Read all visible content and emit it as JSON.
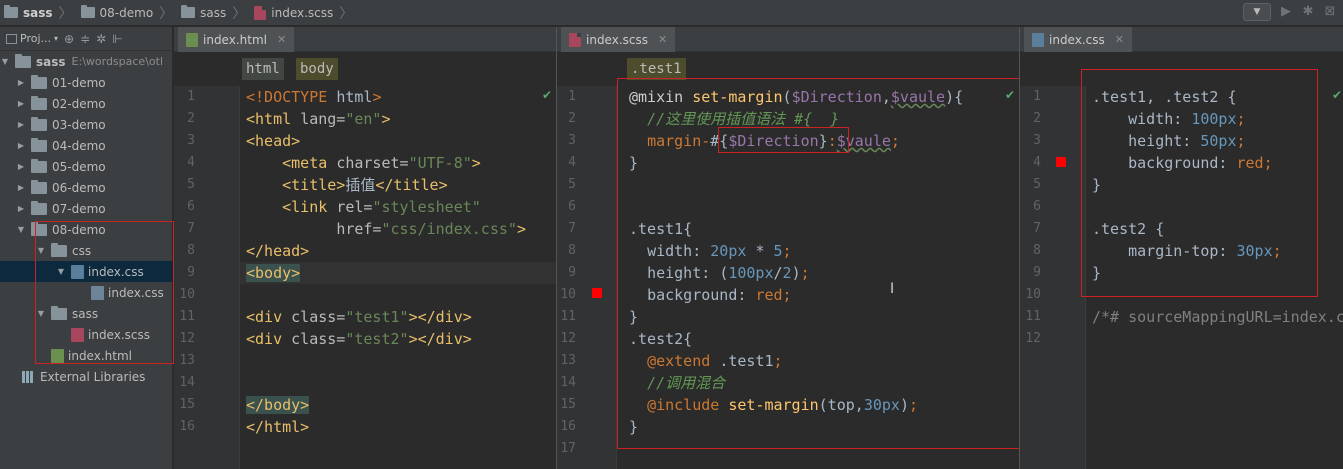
{
  "breadcrumb": [
    "sass",
    "08-demo",
    "sass",
    "index.scss"
  ],
  "toolbar_icons": [
    "dropdown-icon",
    "run-icon",
    "debug-icon",
    "coverage-icon"
  ],
  "project": {
    "tab_label": "Proj...",
    "root": {
      "name": "sass",
      "path": "E:\\wordspace\\otl"
    },
    "items": [
      {
        "label": "01-demo",
        "type": "folder"
      },
      {
        "label": "02-demo",
        "type": "folder"
      },
      {
        "label": "03-demo",
        "type": "folder"
      },
      {
        "label": "04-demo",
        "type": "folder"
      },
      {
        "label": "05-demo",
        "type": "folder"
      },
      {
        "label": "06-demo",
        "type": "folder"
      },
      {
        "label": "07-demo",
        "type": "folder"
      },
      {
        "label": "08-demo",
        "type": "folder"
      },
      {
        "label": "css",
        "type": "folder"
      },
      {
        "label": "index.css",
        "type": "css"
      },
      {
        "label": "index.css",
        "type": "map"
      },
      {
        "label": "sass",
        "type": "folder"
      },
      {
        "label": "index.scss",
        "type": "scss"
      },
      {
        "label": "index.html",
        "type": "html"
      },
      {
        "label": "External Libraries",
        "type": "lib"
      }
    ]
  },
  "panes": {
    "html": {
      "tab": "index.html",
      "crumbs": [
        "html",
        "body"
      ],
      "line_numbers": [
        "1",
        "2",
        "3",
        "4",
        "5",
        "6",
        "7",
        "8",
        "9",
        "10",
        "11",
        "12",
        "13",
        "14",
        "15",
        "16"
      ]
    },
    "scss": {
      "tab": "index.scss",
      "crumbs": [
        ".test1"
      ],
      "line_numbers": [
        "1",
        "2",
        "3",
        "4",
        "5",
        "6",
        "7",
        "8",
        "9",
        "10",
        "11",
        "12",
        "13",
        "14",
        "15",
        "16",
        "17"
      ]
    },
    "css": {
      "tab": "index.css",
      "line_numbers": [
        "1",
        "2",
        "3",
        "4",
        "5",
        "6",
        "7",
        "8",
        "9",
        "10",
        "11",
        "12"
      ]
    }
  },
  "code_html": [
    "<!DOCTYPE html>",
    "<html lang=\"en\">",
    "<head>",
    "    <meta charset=\"UTF-8\">",
    "    <title>插值</title>",
    "    <link rel=\"stylesheet\"",
    "          href=\"css/index.css\">",
    "</head>",
    "<body>",
    "",
    "<div class=\"test1\"></div>",
    "<div class=\"test2\"></div>",
    "",
    "",
    "</body>",
    "</html>"
  ],
  "code_scss": [
    "@mixin set-margin($Direction,$vaule){",
    "  //这里使用插值语法 #{  }",
    "  margin-#{$Direction}:$vaule;",
    "}",
    "",
    "",
    ".test1{",
    "  width: 20px * 5;",
    "  height: (100px/2);",
    "  background: red;",
    "}",
    ".test2{",
    "  @extend .test1;",
    "  //调用混合",
    "  @include set-margin(top,30px);",
    "}",
    ""
  ],
  "code_css": [
    ".test1, .test2 {",
    "    width: 100px;",
    "    height: 50px;",
    "    background: red;",
    "}",
    "",
    ".test2 {",
    "    margin-top: 30px;",
    "}",
    "",
    "/*# sourceMappingURL=index.css.map */",
    ""
  ]
}
